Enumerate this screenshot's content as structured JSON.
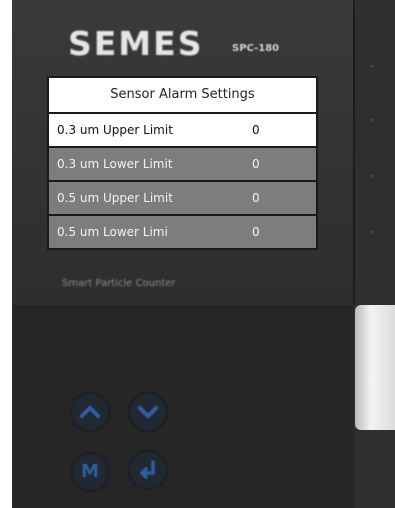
{
  "device": {
    "brand": "SEMES",
    "model": "SPC-180",
    "subtitle": "Smart Particle Counter"
  },
  "settings": {
    "title": "Sensor Alarm Settings",
    "rows": [
      {
        "label": "0.3 um Upper Limit",
        "value": "0",
        "selected": true
      },
      {
        "label": "0.3 um Lower Limit",
        "value": "0",
        "selected": false
      },
      {
        "label": "0.5 um Upper Limit",
        "value": "0",
        "selected": false
      },
      {
        "label": "0.5 um Lower Limi",
        "value": "0",
        "selected": false
      }
    ]
  },
  "buttons": [
    {
      "name": "up",
      "icon": "chevron-up-icon"
    },
    {
      "name": "down",
      "icon": "chevron-down-icon"
    },
    {
      "name": "menu",
      "icon": "m-letter-icon",
      "letter": "M"
    },
    {
      "name": "enter",
      "icon": "enter-return-icon"
    }
  ],
  "colors": {
    "button_accent": "#2d5fa6",
    "row_selected": "#ffffff",
    "row_normal": "#7d7d7d"
  }
}
